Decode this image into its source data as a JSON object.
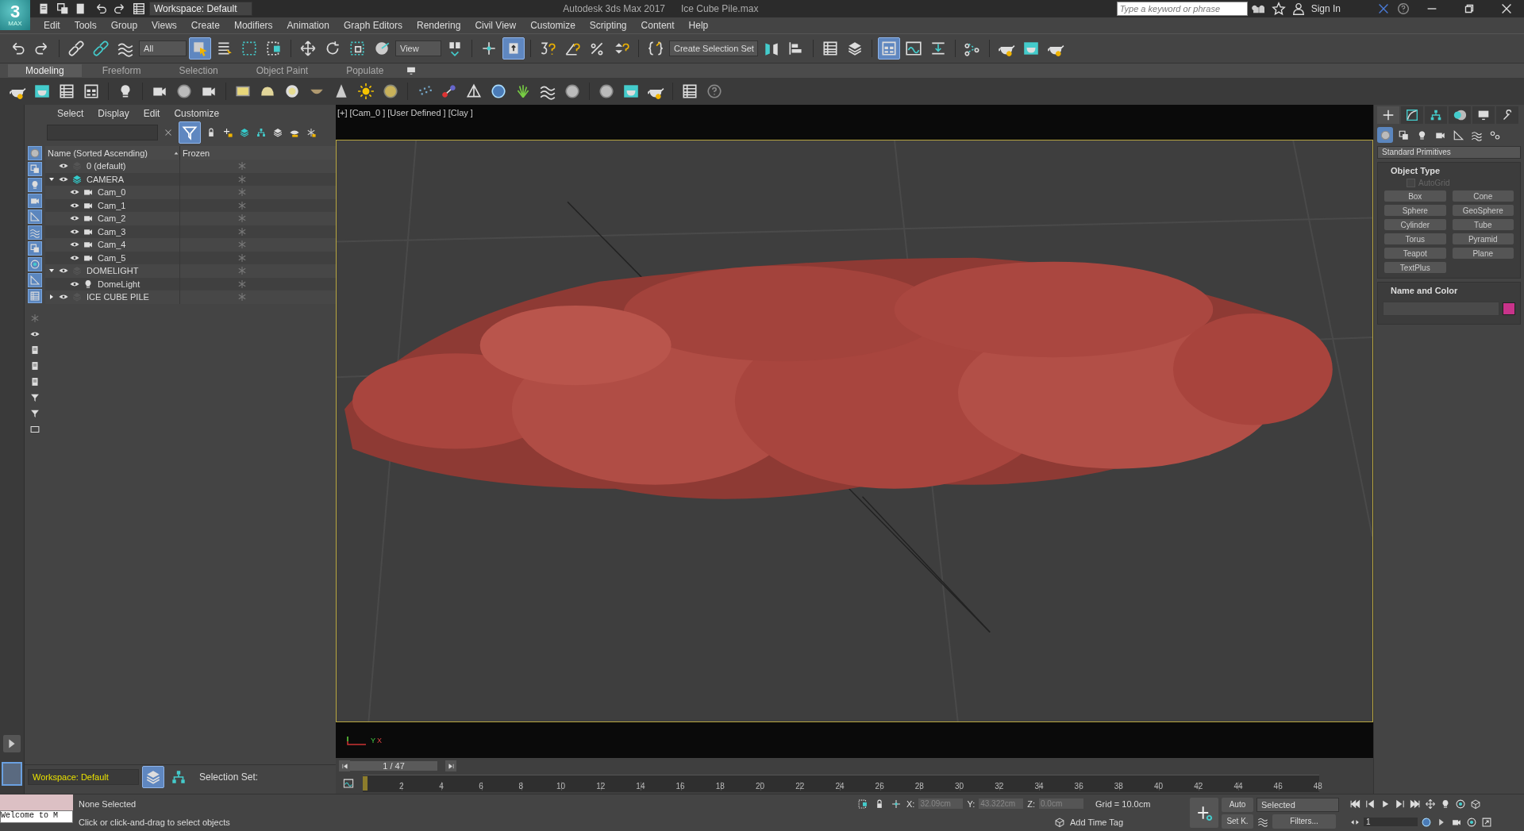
{
  "title_bar": {
    "logo": "3",
    "logo_sub": "MAX",
    "workspace": "Workspace: Default",
    "app_title": "Autodesk 3ds Max 2017",
    "file_name": "Ice Cube Pile.max",
    "search": {
      "placeholder": "Type a keyword or phrase"
    },
    "sign_in": "Sign In"
  },
  "menu": [
    "Edit",
    "Tools",
    "Group",
    "Views",
    "Create",
    "Modifiers",
    "Animation",
    "Graph Editors",
    "Rendering",
    "Civil View",
    "Customize",
    "Scripting",
    "Content",
    "Help"
  ],
  "main_toolbar": {
    "selection_filter": "All",
    "reference_coordinate": "View",
    "selection_set": "Create Selection Set",
    "toggles": {
      "select_object": true,
      "keyboard_shortcut_override": true,
      "ribbon": true
    }
  },
  "ribbon_tabs": [
    {
      "label": "Modeling",
      "selected": true
    },
    {
      "label": "Freeform",
      "selected": false
    },
    {
      "label": "Selection",
      "selected": false
    },
    {
      "label": "Object Paint",
      "selected": false
    },
    {
      "label": "Populate",
      "selected": false
    }
  ],
  "scene_explorer": {
    "menu": [
      "Select",
      "Display",
      "Edit",
      "Customize"
    ],
    "filter_active": true,
    "columns": [
      "Name (Sorted Ascending)",
      "Frozen"
    ],
    "rows": [
      {
        "name": "0 (default)",
        "kind": "layer",
        "active": false
      },
      {
        "name": "CAMERA",
        "kind": "layer",
        "expanded": true,
        "active": true,
        "children": [
          {
            "name": "Cam_0",
            "kind": "camera"
          },
          {
            "name": "Cam_1",
            "kind": "camera"
          },
          {
            "name": "Cam_2",
            "kind": "camera"
          },
          {
            "name": "Cam_3",
            "kind": "camera"
          },
          {
            "name": "Cam_4",
            "kind": "camera"
          },
          {
            "name": "Cam_5",
            "kind": "camera"
          }
        ]
      },
      {
        "name": "DOMELIGHT",
        "kind": "layer",
        "expanded": true,
        "active": false,
        "children": [
          {
            "name": "DomeLight",
            "kind": "light"
          }
        ]
      },
      {
        "name": "ICE CUBE PILE",
        "kind": "layer",
        "expanded": false,
        "active": false
      }
    ],
    "workspace": "Workspace: Default",
    "selection_set_label": "Selection Set:"
  },
  "viewport": {
    "label": "[+] [Cam_0 ] [User Defined ] [Clay ]",
    "axis_labels": [
      "Y",
      "X"
    ]
  },
  "command_panel": {
    "tabs": [
      {
        "selected": true
      },
      {
        "selected": false
      },
      {
        "selected": false
      },
      {
        "selected": false
      },
      {
        "selected": false
      },
      {
        "selected": false
      }
    ],
    "categories": [
      {
        "selected": true
      },
      {
        "selected": false
      },
      {
        "selected": false
      },
      {
        "selected": false
      },
      {
        "selected": false
      },
      {
        "selected": false
      },
      {
        "selected": false
      }
    ],
    "category": "Standard Primitives",
    "object_type": {
      "title": "Object Type",
      "autogrid": {
        "label": "AutoGrid",
        "checked": false,
        "disabled": true
      },
      "buttons": [
        "Box",
        "Cone",
        "Sphere",
        "GeoSphere",
        "Cylinder",
        "Tube",
        "Torus",
        "Pyramid",
        "Teapot",
        "Plane",
        "TextPlus"
      ]
    },
    "name_and_color": {
      "title": "Name and Color",
      "color": "#c8338a"
    }
  },
  "time_slider": {
    "position": "1 / 47",
    "level": 0
  },
  "track_bar": {
    "ticks": [
      "2",
      "4",
      "6",
      "8",
      "10",
      "12",
      "14",
      "16",
      "18",
      "20",
      "22",
      "24",
      "26",
      "28",
      "30",
      "32",
      "34",
      "36",
      "38",
      "40",
      "42",
      "44",
      "46",
      "48"
    ]
  },
  "status_bar": {
    "listener": "Welcome to M",
    "selection": "None Selected",
    "prompt": "Click or click-and-drag to select objects",
    "coords": [
      {
        "label": "X:",
        "value": "32.09cm"
      },
      {
        "label": "Y:",
        "value": "43.322cm"
      },
      {
        "label": "Z:",
        "value": "0.0cm"
      }
    ],
    "grid": "Grid = 10.0cm",
    "add_time_tag": "Add Time Tag",
    "auto_key": "Auto",
    "set_key": "Set K.",
    "key_filter": "Selected",
    "filters": "Filters...",
    "frame": "1"
  }
}
